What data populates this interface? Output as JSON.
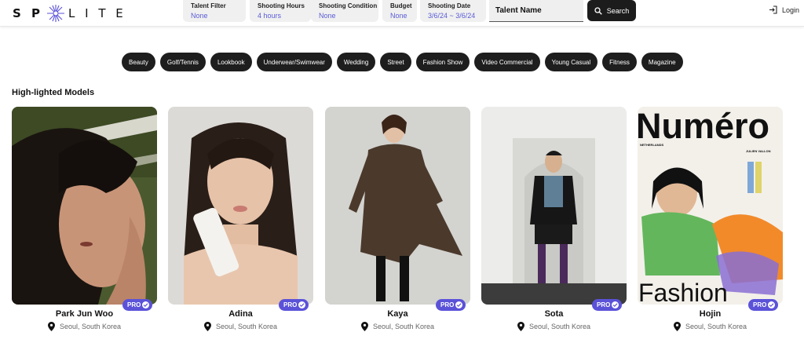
{
  "brand": {
    "left": "S P",
    "right": "L I T E"
  },
  "filters": [
    {
      "title": "Talent Filter",
      "value": "None"
    },
    {
      "title": "Shooting Hours",
      "value": "4 hours"
    },
    {
      "title": "Shooting Condition",
      "value": "None"
    },
    {
      "title": "Budget",
      "value": "None"
    },
    {
      "title": "Shooting Date",
      "value": "3/6/24 ~ 3/6/24"
    }
  ],
  "search": {
    "talent_label": "Talent Name",
    "button_label": "Search"
  },
  "auth": {
    "login_label": "Login"
  },
  "categories": [
    "Beauty",
    "Golf/Tennis",
    "Lookbook",
    "Underwear/Swimwear",
    "Wedding",
    "Street",
    "Fashion Show",
    "Video Commercial",
    "Young Casual",
    "Fitness",
    "Magazine"
  ],
  "section_title": "High-lighted Models",
  "models": [
    {
      "name": "Park Jun Woo",
      "location": "Seoul, South Korea",
      "badge": "PRO"
    },
    {
      "name": "Adina",
      "location": "Seoul, South Korea",
      "badge": "PRO"
    },
    {
      "name": "Kaya",
      "location": "Seoul, South Korea",
      "badge": "PRO"
    },
    {
      "name": "Sota",
      "location": "Seoul, South Korea",
      "badge": "PRO"
    },
    {
      "name": "Hojin",
      "location": "Seoul, South Korea",
      "badge": "PRO"
    }
  ],
  "magazine_cover": {
    "masthead": "Numéro",
    "footer": "Fashion",
    "country": "NETHERLANDS",
    "credit": "JULIEN VALLON"
  },
  "colors": {
    "accent": "#5b52d9",
    "chip_bg": "#1e1e1e",
    "filter_value": "#5a5bd6"
  }
}
